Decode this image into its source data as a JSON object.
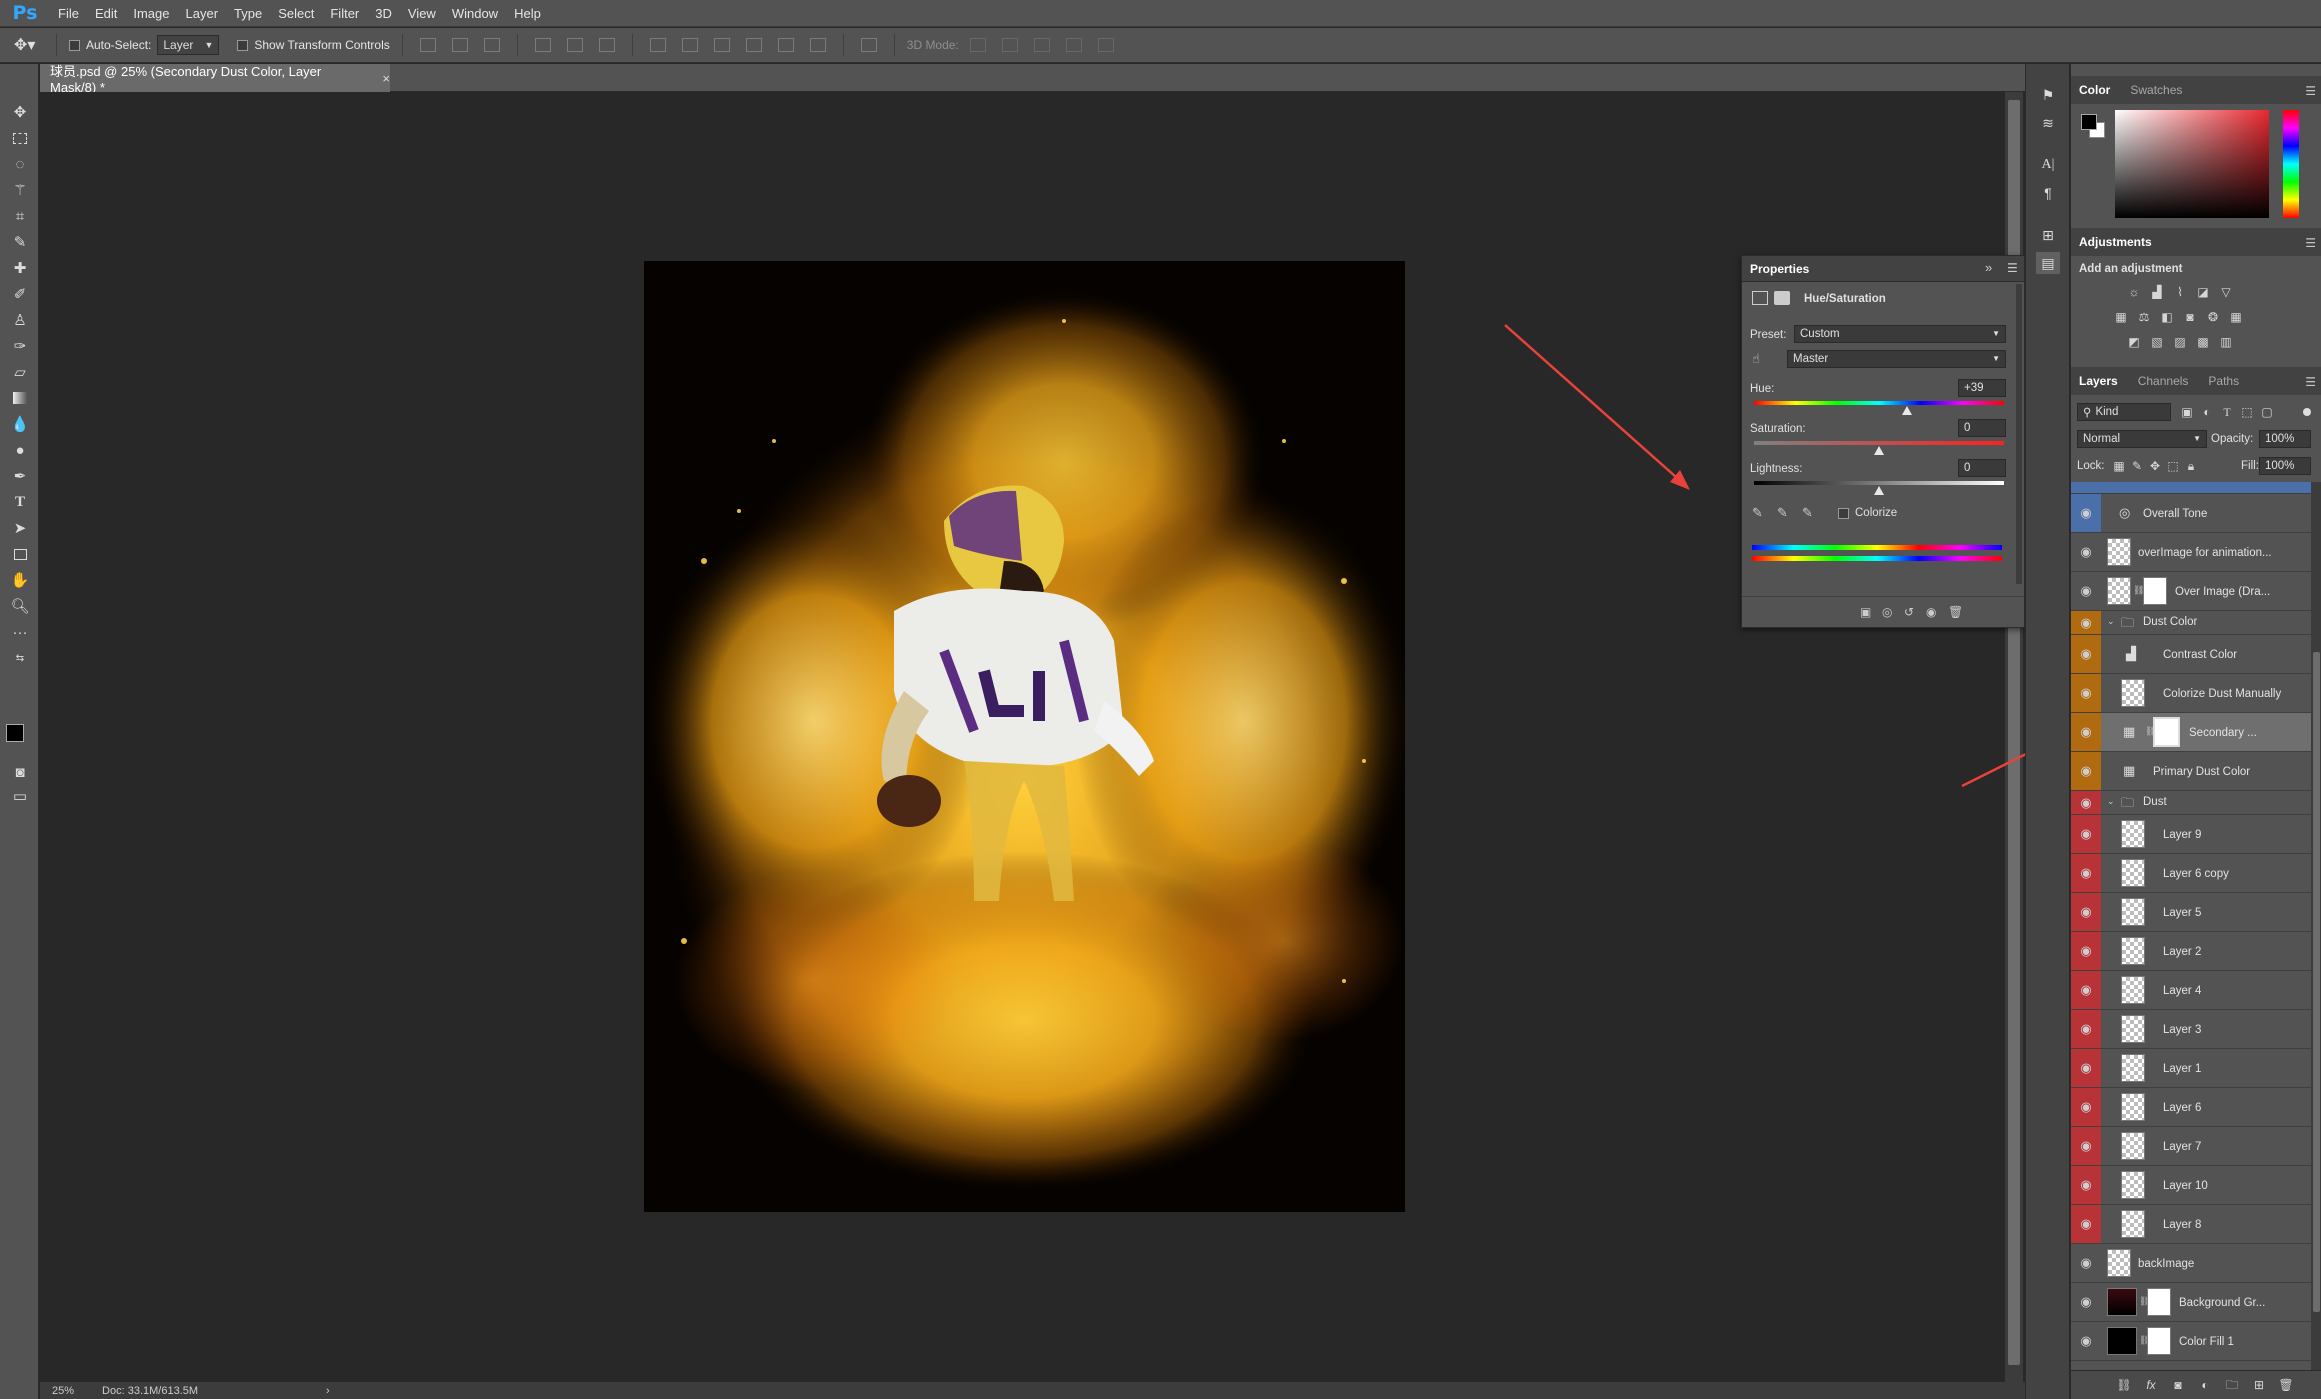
{
  "app": {
    "logo": "Ps"
  },
  "menu": [
    "File",
    "Edit",
    "Image",
    "Layer",
    "Type",
    "Select",
    "Filter",
    "3D",
    "View",
    "Window",
    "Help"
  ],
  "options": {
    "auto_select_label": "Auto-Select:",
    "auto_select_value": "Layer",
    "show_transform_label": "Show Transform Controls",
    "mode3d_label": "3D Mode:"
  },
  "document": {
    "tab_title": "球员.psd @ 25% (Secondary Dust Color, Layer Mask/8) *",
    "close": "×"
  },
  "status": {
    "zoom": "25%",
    "doc": "Doc: 33.1M/613.5M",
    "arrow": "›"
  },
  "color_panel": {
    "tabs": [
      "Color",
      "Swatches"
    ]
  },
  "adjustments": {
    "title": "Adjustments",
    "subtitle": "Add an adjustment"
  },
  "properties": {
    "title": "Properties",
    "collapse": "»",
    "adj_name": "Hue/Saturation",
    "preset_label": "Preset:",
    "preset_value": "Custom",
    "channel_value": "Master",
    "hue_label": "Hue:",
    "hue_value": "+39",
    "hue_fraction": 0.61,
    "sat_label": "Saturation:",
    "sat_value": "0",
    "sat_fraction": 0.5,
    "light_label": "Lightness:",
    "light_value": "0",
    "light_fraction": 0.5,
    "colorize_label": "Colorize"
  },
  "layers_panel": {
    "tabs": [
      "Layers",
      "Channels",
      "Paths"
    ],
    "kind": "Kind",
    "blend_mode": "Normal",
    "opacity_label": "Opacity:",
    "opacity_value": "100%",
    "lock_label": "Lock:",
    "fill_label": "Fill:",
    "fill_value": "100%",
    "items": [
      {
        "name": "Overall Tone"
      },
      {
        "name": "overImage for animation..."
      },
      {
        "name": "Over Image (Dra..."
      },
      {
        "name": "Dust Color"
      },
      {
        "name": "Contrast Color"
      },
      {
        "name": "Colorize Dust Manually"
      },
      {
        "name": "Secondary ..."
      },
      {
        "name": "Primary Dust Color"
      },
      {
        "name": "Dust"
      },
      {
        "name": "Layer 9"
      },
      {
        "name": "Layer 6 copy"
      },
      {
        "name": "Layer 5"
      },
      {
        "name": "Layer 2"
      },
      {
        "name": "Layer 4"
      },
      {
        "name": "Layer 3"
      },
      {
        "name": "Layer 1"
      },
      {
        "name": "Layer 6"
      },
      {
        "name": "Layer 7"
      },
      {
        "name": "Layer 10"
      },
      {
        "name": "Layer 8"
      },
      {
        "name": "backImage"
      },
      {
        "name": "Background Gr..."
      },
      {
        "name": "Color Fill 1"
      }
    ]
  },
  "colors": {
    "accent": "#31a8ff",
    "blue_tag": "#4b6fa8",
    "orange_tag": "#b06b10",
    "red_tag": "#b73338",
    "annotation_arrow": "#e8423a"
  }
}
